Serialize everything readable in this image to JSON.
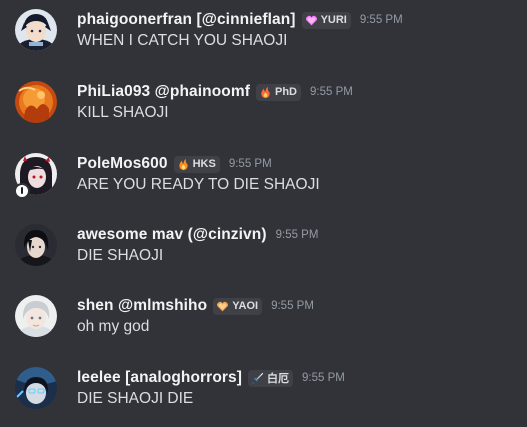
{
  "messages": [
    {
      "username": "phaigoonerfran [@cinnieflan]",
      "tag": {
        "label": "YURI",
        "icon": "pink-heart-icon"
      },
      "timestamp": "9:55 PM",
      "text": "WHEN I CATCH YOU SHAOJI"
    },
    {
      "username": "PhiLia093 @phainoomf",
      "tag": {
        "label": "PhD",
        "icon": "fire-icon"
      },
      "timestamp": "9:55 PM",
      "text": "KILL SHAOJI"
    },
    {
      "username": "PoleMos600",
      "tag": {
        "label": "HKS",
        "icon": "fire-icon"
      },
      "timestamp": "9:55 PM",
      "text": "ARE YOU READY TO DIE SHAOJI"
    },
    {
      "username": "awesome mav (@cinzivn)",
      "timestamp": "9:55 PM",
      "text": "DIE SHAOJI"
    },
    {
      "username": "shen @mlmshiho",
      "tag": {
        "label": "YAOI",
        "icon": "orange-heart-icon"
      },
      "timestamp": "9:55 PM",
      "text": "oh my god"
    },
    {
      "username": "leelee [analoghorrors]",
      "tag": {
        "label": "白厄",
        "icon": "sword-icon"
      },
      "timestamp": "9:55 PM",
      "text": "DIE SHAOJI DIE"
    }
  ],
  "colors": {
    "background": "#313338",
    "username": "#f2f3f5",
    "message_text": "#dbdee1",
    "timestamp": "#949ba4",
    "tag_background": "#3f4147"
  }
}
